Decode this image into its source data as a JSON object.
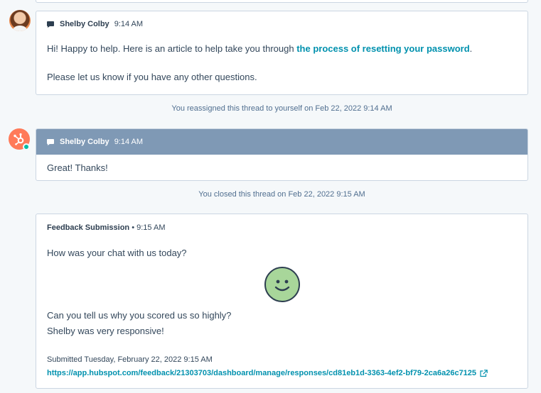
{
  "message1": {
    "sender": "Shelby Colby",
    "time": "9:14 AM",
    "line1_prefix": "Hi! Happy to help. Here is an article to help take you through ",
    "line1_link": "the process of resetting your password",
    "line1_suffix": ".",
    "line2": "Please let us know if you have any other questions."
  },
  "event_reassigned": "You reassigned this thread to yourself on Feb 22, 2022 9:14 AM",
  "message2": {
    "sender": "Shelby Colby",
    "time": "9:14 AM",
    "body": "Great! Thanks!",
    "header_color": "#7f99b5"
  },
  "event_closed": "You closed this thread on Feb 22, 2022 9:15 AM",
  "feedback": {
    "title": "Feedback Submission",
    "time": "• 9:15 AM",
    "question1": "How was your chat with us today?",
    "rating_icon": "smiley-face-icon",
    "question2": "Can you tell us why you scored us so highly?",
    "answer2": "Shelby was very responsive!",
    "submitted": "Submitted Tuesday, February 22, 2022 9:15 AM",
    "link": "https://app.hubspot.com/feedback/21303703/dashboard/manage/responses/cd81eb1d-3363-4ef2-bf79-2ca6a26c7125",
    "link_icon": "external-link-icon"
  },
  "colors": {
    "link": "#0091ae",
    "hubspot_orange": "#ff7a59",
    "online": "#00bda5"
  }
}
